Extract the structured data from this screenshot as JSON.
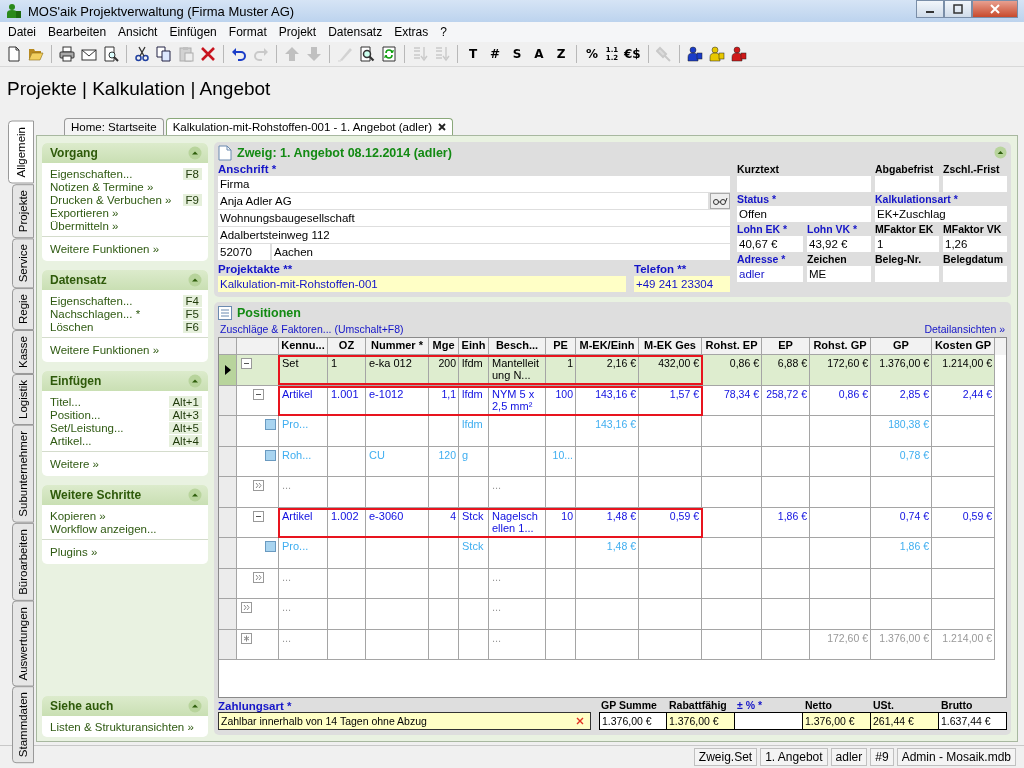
{
  "window": {
    "title": "MOS'aik Projektverwaltung (Firma Muster AG)"
  },
  "menu": [
    "Datei",
    "Bearbeiten",
    "Ansicht",
    "Einfügen",
    "Format",
    "Projekt",
    "Datensatz",
    "Extras",
    "?"
  ],
  "toolbar": [
    [
      {
        "kind": "icon",
        "disabled": false
      },
      {
        "kind": "icon",
        "disabled": false
      }
    ],
    [
      {
        "kind": "icon",
        "disabled": false
      },
      {
        "kind": "icon",
        "disabled": false
      },
      {
        "kind": "icon",
        "disabled": false
      }
    ],
    [
      {
        "kind": "icon",
        "disabled": false
      },
      {
        "kind": "icon",
        "disabled": false
      },
      {
        "kind": "icon",
        "disabled": true
      },
      {
        "kind": "icon",
        "disabled": false
      }
    ],
    [
      {
        "kind": "icon",
        "disabled": false
      },
      {
        "kind": "icon",
        "disabled": true
      }
    ],
    [
      {
        "kind": "icon",
        "disabled": true
      },
      {
        "kind": "icon",
        "disabled": true
      }
    ],
    [
      {
        "kind": "icon",
        "disabled": true
      },
      {
        "kind": "icon",
        "disabled": false
      },
      {
        "kind": "icon",
        "disabled": false
      }
    ],
    [
      {
        "kind": "icon",
        "disabled": true
      },
      {
        "kind": "icon",
        "disabled": true
      }
    ],
    [
      {
        "kind": "text",
        "label": "T"
      },
      {
        "kind": "text",
        "label": "#"
      },
      {
        "kind": "text",
        "label": "S"
      },
      {
        "kind": "text",
        "label": "A"
      },
      {
        "kind": "text",
        "label": "Z"
      }
    ],
    [
      {
        "kind": "text",
        "label": "%"
      },
      {
        "kind": "stacked",
        "label": "1.1 1.2"
      },
      {
        "kind": "text",
        "label": "€$"
      }
    ],
    [
      {
        "kind": "icon",
        "disabled": true
      }
    ],
    [
      {
        "kind": "icon",
        "disabled": false,
        "color": "#1a3cc8"
      },
      {
        "kind": "icon",
        "disabled": false,
        "color": "#e8c800"
      },
      {
        "kind": "icon",
        "disabled": false,
        "color": "#d01818"
      }
    ]
  ],
  "breadcrumb": "Projekte | Kalkulation | Angebot",
  "side_tabs": [
    {
      "label": "Allgemein",
      "selected": true
    },
    {
      "label": "Projekte",
      "selected": false
    },
    {
      "label": "Service",
      "selected": false
    },
    {
      "label": "Regie",
      "selected": false
    },
    {
      "label": "Kasse",
      "selected": false
    },
    {
      "label": "Logistik",
      "selected": false
    },
    {
      "label": "Subunternehmer",
      "selected": false
    },
    {
      "label": "Büroarbeiten",
      "selected": false
    },
    {
      "label": "Auswertungen",
      "selected": false
    },
    {
      "label": "Stammdaten",
      "selected": false
    }
  ],
  "doc_tabs": [
    {
      "label": "Home: Startseite",
      "selected": false
    },
    {
      "label": "Kalkulation-mit-Rohstoffen-001 - 1. Angebot (adler)",
      "selected": true
    }
  ],
  "task_sections": [
    {
      "title": "Vorgang",
      "expanded": true,
      "items": [
        {
          "label": "Eigenschaften...",
          "shortcut": "F8"
        },
        {
          "label": "Notizen & Termine »"
        },
        {
          "label": "Drucken & Verbuchen »",
          "shortcut": "F9"
        },
        {
          "label": "Exportieren »"
        },
        {
          "label": "Übermitteln »"
        }
      ],
      "footer": [
        "Weitere Funktionen »"
      ]
    },
    {
      "title": "Datensatz",
      "expanded": true,
      "items": [
        {
          "label": "Eigenschaften...",
          "shortcut": "F4"
        },
        {
          "label": "Nachschlagen... *",
          "shortcut": "F5"
        },
        {
          "label": "Löschen",
          "shortcut": "F6"
        }
      ],
      "footer": [
        "Weitere Funktionen »"
      ]
    },
    {
      "title": "Einfügen",
      "expanded": true,
      "items": [
        {
          "label": "Titel...",
          "shortcut": "Alt+1"
        },
        {
          "label": "Position...",
          "shortcut": "Alt+3"
        },
        {
          "label": "Set/Leistung...",
          "shortcut": "Alt+5"
        },
        {
          "label": "Artikel...",
          "shortcut": "Alt+4"
        }
      ],
      "footer": [
        "Weitere »"
      ]
    },
    {
      "title": "Weitere Schritte",
      "expanded": true,
      "items": [
        {
          "label": "Kopieren »"
        },
        {
          "label": "Workflow anzeigen..."
        }
      ],
      "footer": [
        "Plugins »"
      ]
    },
    {
      "title": "Siehe auch",
      "expanded": true,
      "items": [
        {
          "label": "Listen & Strukturansichten »"
        }
      ]
    }
  ],
  "branch_panel": {
    "title": "Zweig: 1. Angebot 08.12.2014 (adler)",
    "expanded": true,
    "address": {
      "label": "Anschrift *",
      "required": true,
      "lines": [
        "Firma",
        "Anja Adler AG",
        "Wohnungsbaugesellschaft",
        "Adalbertsteinweg 112"
      ],
      "zip": "52070",
      "city": "Aachen"
    },
    "bottom_fields": [
      {
        "label": "Projektakte **",
        "required": true,
        "emphasized": true,
        "linked": true,
        "value": "Kalkulation-mit-Rohstoffen-001"
      },
      {
        "label": "Telefon **",
        "required": true,
        "emphasized": true,
        "linked": true,
        "value": "+49 241 23304"
      }
    ],
    "side_fields": [
      [
        {
          "label": "Kurztext",
          "required": false,
          "emphasized": false
        },
        {
          "label": "Abgabefrist",
          "required": false,
          "emphasized": false
        },
        {
          "label": "Zschl.-Frist",
          "required": false,
          "emphasized": false
        }
      ],
      [
        {
          "label": "Status *",
          "required": true,
          "emphasized": false,
          "linked": false,
          "value": "Offen"
        },
        {
          "label": "Kalkulationsart *",
          "required": true,
          "emphasized": false,
          "linked": false,
          "value": "EK+Zuschlag"
        }
      ],
      [
        {
          "label": "Lohn EK *",
          "required": true,
          "emphasized": false,
          "linked": false,
          "value": "40,67 €"
        },
        {
          "label": "Lohn VK *",
          "required": true,
          "emphasized": false,
          "linked": false,
          "value": "43,92 €"
        },
        {
          "label": "MFaktor EK",
          "required": false,
          "emphasized": false,
          "linked": false,
          "value": "1"
        },
        {
          "label": "MFaktor VK",
          "required": false,
          "emphasized": false,
          "linked": false,
          "value": "1,26"
        }
      ],
      [
        {
          "label": "Adresse *",
          "required": true,
          "emphasized": false,
          "linked": true,
          "value": "adler"
        },
        {
          "label": "Zeichen",
          "required": false,
          "emphasized": false,
          "linked": false,
          "value": "ME"
        },
        {
          "label": "Beleg-Nr.",
          "required": false,
          "emphasized": false
        },
        {
          "label": "Belegdatum",
          "required": false,
          "emphasized": false
        }
      ]
    ]
  },
  "positions": {
    "title": "Positionen",
    "surcharges_link": "Zuschläge & Faktoren... (Umschalt+F8)",
    "details_link": "Detailansichten »",
    "columns": [
      "Kennu...",
      "OZ",
      "Nummer *",
      "Mge",
      "Einh",
      "Besch...",
      "PE",
      "M-EK/Einh",
      "M-EK Ges",
      "Rohst. EP",
      "EP",
      "Rohst. GP",
      "GP",
      "Kosten GP"
    ],
    "rows": [
      {
        "kind": "set",
        "selected": true,
        "expanded": true,
        "highlighted": true,
        "cells": [
          "Set",
          "1",
          "e-ka 012",
          "200",
          "lfdm",
          "Mantelleitung N...",
          "1",
          "2,16 €",
          "432,00 €",
          "0,86 €",
          "6,88 €",
          "172,60 €",
          "1.376,00 €",
          "1.214,00 €"
        ],
        "children": [
          {
            "kind": "artikel",
            "selected": false,
            "expanded": true,
            "highlighted": true,
            "cells": [
              "Artikel",
              "1.001",
              "e-1012",
              "1,1",
              "lfdm",
              "NYM 5 x 2,5 mm²",
              "100",
              "143,16 €",
              "1,57 €",
              "78,34 €",
              "258,72 €",
              "0,86 €",
              "2,85 €",
              "2,44 €"
            ],
            "children": [
              {
                "kind": "component",
                "selected": false,
                "cells": [
                  "Pro...",
                  null,
                  null,
                  null,
                  "lfdm",
                  null,
                  null,
                  "143,16 €",
                  null,
                  null,
                  null,
                  null,
                  "180,38 €",
                  null
                ]
              },
              {
                "kind": "component",
                "selected": false,
                "cells": [
                  "Roh...",
                  null,
                  "CU",
                  "120",
                  "g",
                  null,
                  "10...",
                  null,
                  null,
                  null,
                  null,
                  null,
                  "0,78 €",
                  null
                ]
              }
            ]
          },
          {
            "kind": "more",
            "selected": false,
            "cells": [
              "...",
              null,
              null,
              null,
              null,
              "...",
              null,
              null,
              null,
              null,
              null,
              null,
              null,
              null
            ]
          },
          {
            "kind": "artikel",
            "selected": false,
            "expanded": true,
            "highlighted": true,
            "cells": [
              "Artikel",
              "1.002",
              "e-3060",
              "4",
              "Stck",
              "Nagelschellen 1...",
              "10",
              "1,48 €",
              "0,59 €",
              null,
              "1,86 €",
              null,
              "0,74 €",
              "0,59 €"
            ],
            "children": [
              {
                "kind": "component",
                "selected": false,
                "cells": [
                  "Pro...",
                  null,
                  null,
                  null,
                  "Stck",
                  null,
                  null,
                  "1,48 €",
                  null,
                  null,
                  null,
                  null,
                  "1,86 €",
                  null
                ]
              }
            ]
          },
          {
            "kind": "more",
            "selected": false,
            "cells": [
              "...",
              null,
              null,
              null,
              null,
              "...",
              null,
              null,
              null,
              null,
              null,
              null,
              null,
              null
            ]
          }
        ]
      },
      {
        "kind": "more",
        "selected": false,
        "cells": [
          "...",
          null,
          null,
          null,
          null,
          "...",
          null,
          null,
          null,
          null,
          null,
          null,
          null,
          null
        ]
      },
      {
        "kind": "new",
        "selected": false,
        "cells": [
          "...",
          null,
          null,
          null,
          null,
          "...",
          null,
          null,
          null,
          null,
          null,
          "172,60 €",
          "1.376,00 €",
          "1.214,00 €"
        ]
      }
    ]
  },
  "payment": {
    "label": "Zahlungsart *",
    "required": true,
    "value": "Zahlbar innerhalb von 14 Tagen ohne Abzug"
  },
  "totals": [
    {
      "label": "GP Summe",
      "required": false,
      "emphasized": false,
      "value": "1.376,00 €"
    },
    {
      "label": "Rabattfähig",
      "required": false,
      "emphasized": true,
      "value": "1.376,00 €"
    },
    {
      "label": "± % *",
      "required": true,
      "emphasized": false
    },
    {
      "label": "Netto",
      "required": false,
      "emphasized": true,
      "value": "1.376,00 €"
    },
    {
      "label": "USt.",
      "required": false,
      "emphasized": true,
      "value": "261,44 €"
    },
    {
      "label": "Brutto",
      "required": false,
      "emphasized": false,
      "value": "1.637,44 €"
    }
  ],
  "status_bar": [
    "Zweig.Set",
    "1. Angebot",
    "adler",
    "#9",
    "Admin - Mosaik.mdb"
  ]
}
